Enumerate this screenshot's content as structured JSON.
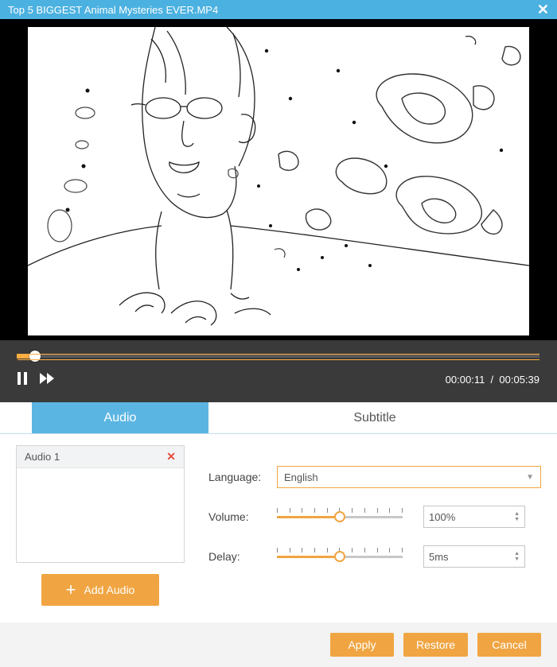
{
  "title": "Top 5 BIGGEST Animal Mysteries EVER.MP4",
  "playback": {
    "current_time": "00:00:11",
    "duration": "00:05:39",
    "separator": "/"
  },
  "tabs": {
    "audio": "Audio",
    "subtitle": "Subtitle"
  },
  "audio_list": {
    "item1": "Audio 1"
  },
  "add_audio_label": "Add Audio",
  "form": {
    "language_label": "Language:",
    "language_value": "English",
    "volume_label": "Volume:",
    "volume_value": "100%",
    "delay_label": "Delay:",
    "delay_value": "5ms"
  },
  "buttons": {
    "apply": "Apply",
    "restore": "Restore",
    "cancel": "Cancel"
  }
}
